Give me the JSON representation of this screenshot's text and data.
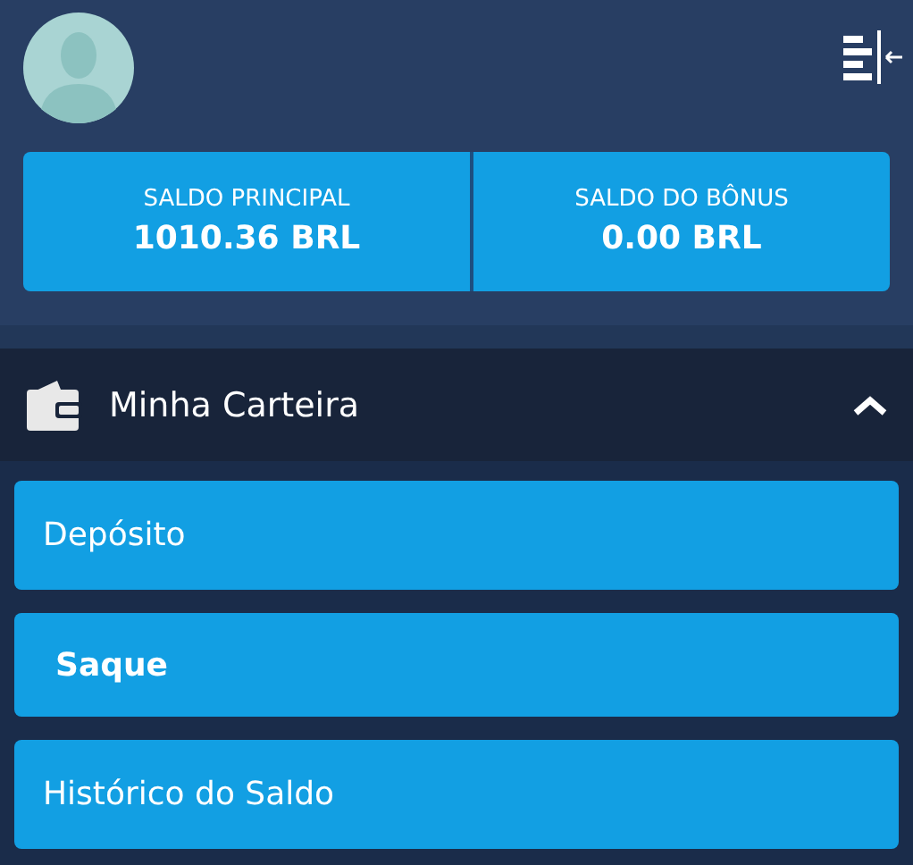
{
  "balances": [
    {
      "label": "SALDO PRINCIPAL",
      "amount": "1010.36 BRL"
    },
    {
      "label": "SALDO DO BÔNUS",
      "amount": "0.00 BRL"
    }
  ],
  "section": {
    "title": "Minha Carteira",
    "expanded": true
  },
  "menu": [
    {
      "label": "Depósito",
      "selected": false
    },
    {
      "label": "Saque",
      "selected": true
    },
    {
      "label": "Histórico do Saldo",
      "selected": false
    }
  ]
}
